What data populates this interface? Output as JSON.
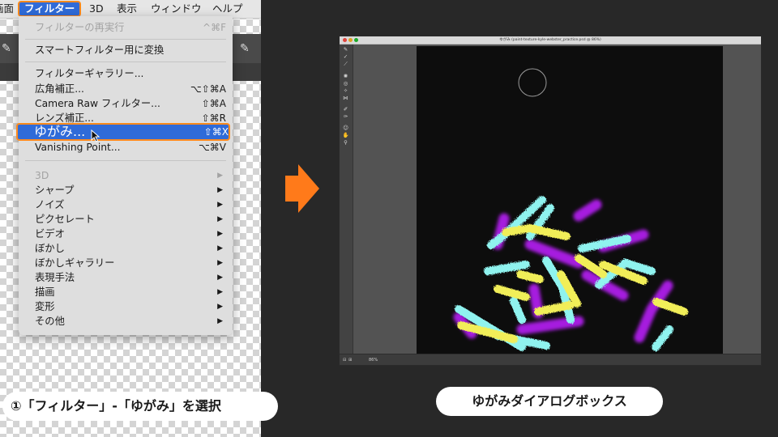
{
  "menubar": {
    "items": [
      "画面",
      "フィルター",
      "3D",
      "表示",
      "ウィンドウ",
      "ヘルプ"
    ]
  },
  "filter_menu": {
    "items": [
      {
        "label": "フィルターの再実行",
        "shortcut": "^⌘F",
        "disabled": true
      },
      {
        "label": "スマートフィルター用に変換",
        "shortcut": ""
      },
      {
        "label": "フィルターギャラリー...",
        "shortcut": ""
      },
      {
        "label": "広角補正...",
        "shortcut": "⌥⇧⌘A"
      },
      {
        "label": "Camera Raw フィルター...",
        "shortcut": "⇧⌘A"
      },
      {
        "label": "レンズ補正...",
        "shortcut": "⇧⌘R"
      },
      {
        "label": "ゆがみ...",
        "shortcut": "⇧⌘X",
        "highlighted": true
      },
      {
        "label": "Vanishing Point...",
        "shortcut": "⌥⌘V"
      },
      {
        "label": "3D",
        "submenu": true,
        "disabled": true
      },
      {
        "label": "シャープ",
        "submenu": true
      },
      {
        "label": "ノイズ",
        "submenu": true
      },
      {
        "label": "ピクセレート",
        "submenu": true
      },
      {
        "label": "ビデオ",
        "submenu": true
      },
      {
        "label": "ぼかし",
        "submenu": true
      },
      {
        "label": "ぼかしギャラリー",
        "submenu": true
      },
      {
        "label": "表現手法",
        "submenu": true
      },
      {
        "label": "描画",
        "submenu": true
      },
      {
        "label": "変形",
        "submenu": true
      },
      {
        "label": "その他",
        "submenu": true
      }
    ],
    "submenu_arrow": "▶"
  },
  "captions": {
    "left": "①「フィルター」-「ゆがみ」を選択",
    "right": "ゆがみダイアログボックス"
  },
  "dialog": {
    "title": "ゆがみ (paint-texture-kyle-webster_practice.psd @ 86%)",
    "zoom": "86%"
  },
  "colors": {
    "highlight": "#2f6bd8",
    "outline": "#ff8a1c",
    "arrow": "#ff7a1a",
    "stroke_cyan": "#8ff3ef",
    "stroke_yellow": "#f1ee58",
    "stroke_purple": "#a61fdf"
  },
  "icons": [
    "cursor-arrow-icon",
    "right-arrow-icon",
    "brush-tool-icon",
    "hand-tool-icon",
    "zoom-tool-icon"
  ]
}
